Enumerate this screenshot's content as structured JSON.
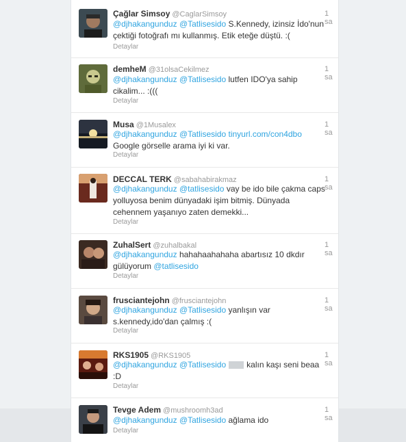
{
  "tweets": [
    {
      "name": "Çağlar Simsoy",
      "handle": "@CaglarSimsoy",
      "time": "1 sa",
      "details": "Detaylar",
      "mention1": "@djhakangunduz",
      "mention2": "@Tatlisesido",
      "body": "S.Kennedy, izinsiz İdo'nun çektiği fotoğrafı mı kullanmış. Etik eteğe düştü. :("
    },
    {
      "name": "demheM",
      "handle": "@31olsaCekilmez",
      "time": "1 sa",
      "details": "Detaylar",
      "mention1": "@djhakangunduz",
      "mention2": "@Tatlisesido",
      "body": "lutfen IDO'ya sahip cikalim... :((("
    },
    {
      "name": "Musa",
      "handle": "@1Musalex",
      "time": "1 sa",
      "details": "Detaylar",
      "mention1": "@djhakangunduz",
      "mention2": "@Tatlisesido",
      "link": "tinyurl.com/con4dbo",
      "body": "Google görselle arama iyi ki var."
    },
    {
      "name": "DECCAL TERK",
      "handle": "@sabahabirakmaz",
      "time": "1 sa",
      "details": "Detaylar",
      "mention1": "@djhakangunduz",
      "mention2": "@tatlisesido",
      "body": "vay be ido bile çakma caps yolluyosa benim dünyadaki işim bitmiş. Dünyada cehennem yaşanıyo zaten demekki..."
    },
    {
      "name": "ZuhalSert",
      "handle": "@zuhalbakal",
      "time": "1 sa",
      "details": "Detaylar",
      "mention1": "@djhakangunduz",
      "body": "hahahaahahaha abartısız 10 dkdır gülüyorum",
      "mention2": "@tatlisesido"
    },
    {
      "name": "frusciantejohn",
      "handle": "@frusciantejohn",
      "time": "1 sa",
      "details": "Detaylar",
      "mention1": "@djhakangunduz",
      "mention2": "@Tatlisesido",
      "body": "yanlışın var s.kennedy,ido'dan çalmış :("
    },
    {
      "name": "RKS1905",
      "handle": "@RKS1905",
      "time": "1 sa",
      "details": "Detaylar",
      "mention1": "@djhakangunduz",
      "mention2": "@Tatlisesido",
      "body": "kalın kaşı seni beaa :D"
    },
    {
      "name": "Tevge Adem",
      "handle": "@mushroomh3ad",
      "time": "1 sa",
      "details": "Detaylar",
      "mention1": "@djhakangunduz",
      "mention2": "@Tatlisesido",
      "body": "ağlama ido"
    }
  ]
}
